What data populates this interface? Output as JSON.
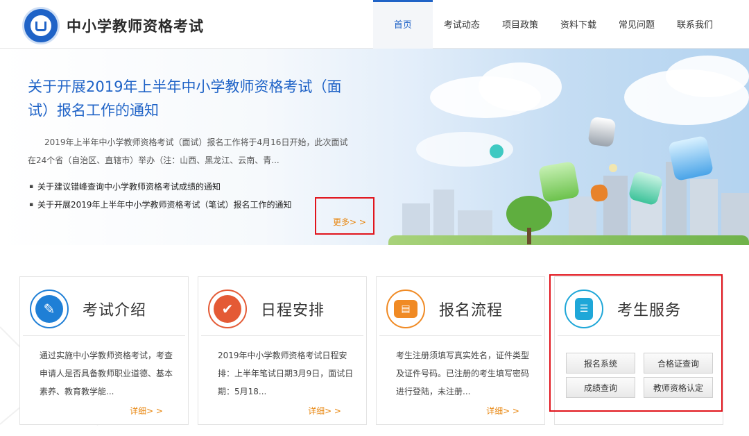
{
  "header": {
    "site_title": "中小学教师资格考试",
    "nav": [
      "首页",
      "考试动态",
      "项目政策",
      "资料下载",
      "常见问题",
      "联系我们"
    ],
    "active_nav": "首页"
  },
  "banner": {
    "title": "关于开展2019年上半年中小学教师资格考试（面试）报名工作的通知",
    "summary": "2019年上半年中小学教师资格考试（面试）报名工作将于4月16日开始，此次面试在24个省（自治区、直辖市）举办（注：山西、黑龙江、云南、青...",
    "links": [
      "关于建议错峰查询中小学教师资格考试成绩的通知",
      "关于开展2019年上半年中小学教师资格考试（笔试）报名工作的通知"
    ],
    "more": "更多> >"
  },
  "cards": [
    {
      "title": "考试介绍",
      "icon": "document-edit-icon",
      "color": "#1f7fd6",
      "text": "通过实施中小学教师资格考试，考查申请人是否具备教师职业道德、基本素养、教育教学能...",
      "detail": "详细> >"
    },
    {
      "title": "日程安排",
      "icon": "checkmark-icon",
      "color": "#e45a35",
      "text": "2019年中小学教师资格考试日程安排：上半年笔试日期3月9日，面试日期：5月18...",
      "detail": "详细> >"
    },
    {
      "title": "报名流程",
      "icon": "id-card-icon",
      "color": "#f08a24",
      "text": "考生注册须填写真实姓名，证件类型及证件号码。已注册的考生填写密码进行登陆，未注册...",
      "detail": "详细> >"
    },
    {
      "title": "考生服务",
      "icon": "contact-book-icon",
      "color": "#1fa7d8",
      "buttons": [
        "报名系统",
        "合格证查询",
        "成绩查询",
        "教师资格认定"
      ]
    }
  ]
}
